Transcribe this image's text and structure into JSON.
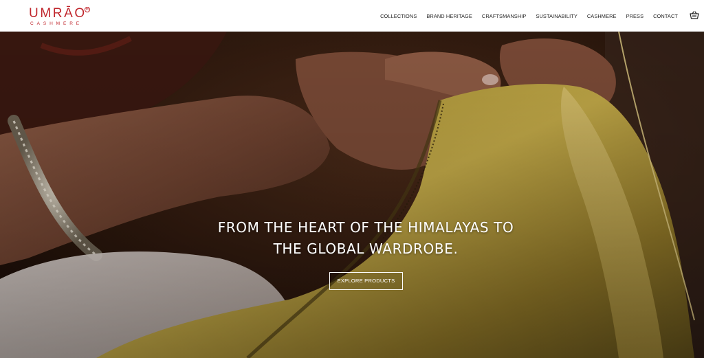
{
  "brand": {
    "name": "UMRĀO",
    "registered": "R",
    "subtitle": "CASHMERE",
    "color": "#c0272d"
  },
  "nav": {
    "items": [
      {
        "label": "COLLECTIONS"
      },
      {
        "label": "BRAND HERITAGE"
      },
      {
        "label": "CRAFTSMANSHIP"
      },
      {
        "label": "SUSTAINABILITY"
      },
      {
        "label": "CASHMERE"
      },
      {
        "label": "PRESS"
      },
      {
        "label": "CONTACT"
      }
    ],
    "cart_icon": "basket-icon"
  },
  "hero": {
    "line1": "FROM THE HEART OF THE HIMALAYAS TO",
    "line2": "THE GLOBAL WARDROBE.",
    "cta_label": "EXPLORE PRODUCTS",
    "image_subject": "hands-weaving-cashmere-photo"
  }
}
